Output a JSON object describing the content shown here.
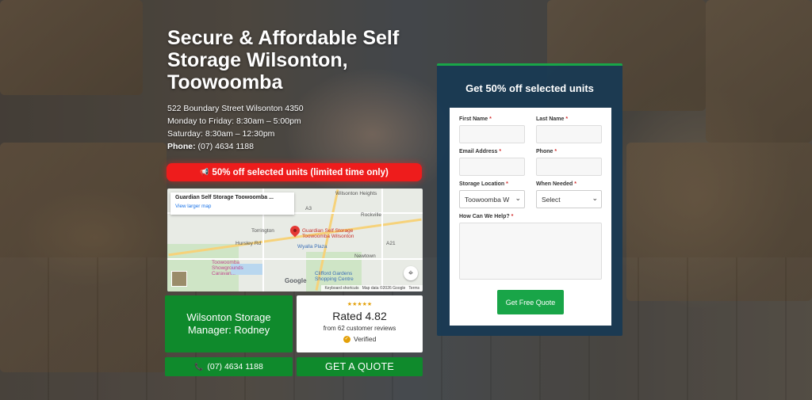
{
  "hero": {
    "title": "Secure & Affordable Self Storage Wilsonton, Toowoomba",
    "address": "522 Boundary Street Wilsonton 4350",
    "hours_weekday": "Monday to Friday: 8:30am – 5:00pm",
    "hours_saturday": "Saturday: 8:30am – 12:30pm",
    "phone_label": "Phone:",
    "phone_value": "(07) 4634 1188"
  },
  "promo": {
    "icon": "megaphone-icon",
    "text": "50% off selected units (limited time only)",
    "color": "#ee1c1c"
  },
  "map": {
    "place_title": "Guardian Self Storage Toowoomba ...",
    "larger_map_link": "View larger map",
    "labels": {
      "wilsonton_heights": "Wilsonton Heights",
      "rockville": "Rockville",
      "torrington": "Torrington",
      "pin_label": "Guardian Self Storage Toowoomba Wilsonton",
      "wyalla_plaza": "Wyalla Plaza",
      "newtown": "Newtown",
      "showgrounds": "Toowoomba Showgrounds Caravan...",
      "clifford_gardens": "Clifford Gardens Shopping Centre",
      "hursley_rd": "Hursley Rd",
      "road_a3": "A3",
      "road_a21": "A21"
    },
    "brand": "Google",
    "footer_shortcuts": "Keyboard shortcuts",
    "footer_data": "Map data ©2026 Google",
    "footer_terms": "Terms"
  },
  "manager": {
    "line1": "Wilsonton Storage",
    "line2": "Manager: Rodney"
  },
  "rating": {
    "stars": "★★★★★",
    "rated": "Rated 4.82",
    "sub": "from 62 customer reviews",
    "verified": "Verified"
  },
  "buttons": {
    "phone": "(07) 4634 1188",
    "quote": "GET A QUOTE"
  },
  "form": {
    "heading": "Get 50% off selected units",
    "first_name_label": "First Name",
    "last_name_label": "Last Name",
    "email_label": "Email Address",
    "phone_label": "Phone",
    "location_label": "Storage Location",
    "location_value": "Toowoomba W",
    "when_label": "When Needed",
    "when_value": "Select",
    "help_label": "How Can We Help?",
    "required_mark": "*",
    "submit": "Get Free Quote"
  },
  "colors": {
    "brand_green": "#0f8a2c",
    "panel_navy": "#183a54",
    "accent_green": "#19a548"
  }
}
